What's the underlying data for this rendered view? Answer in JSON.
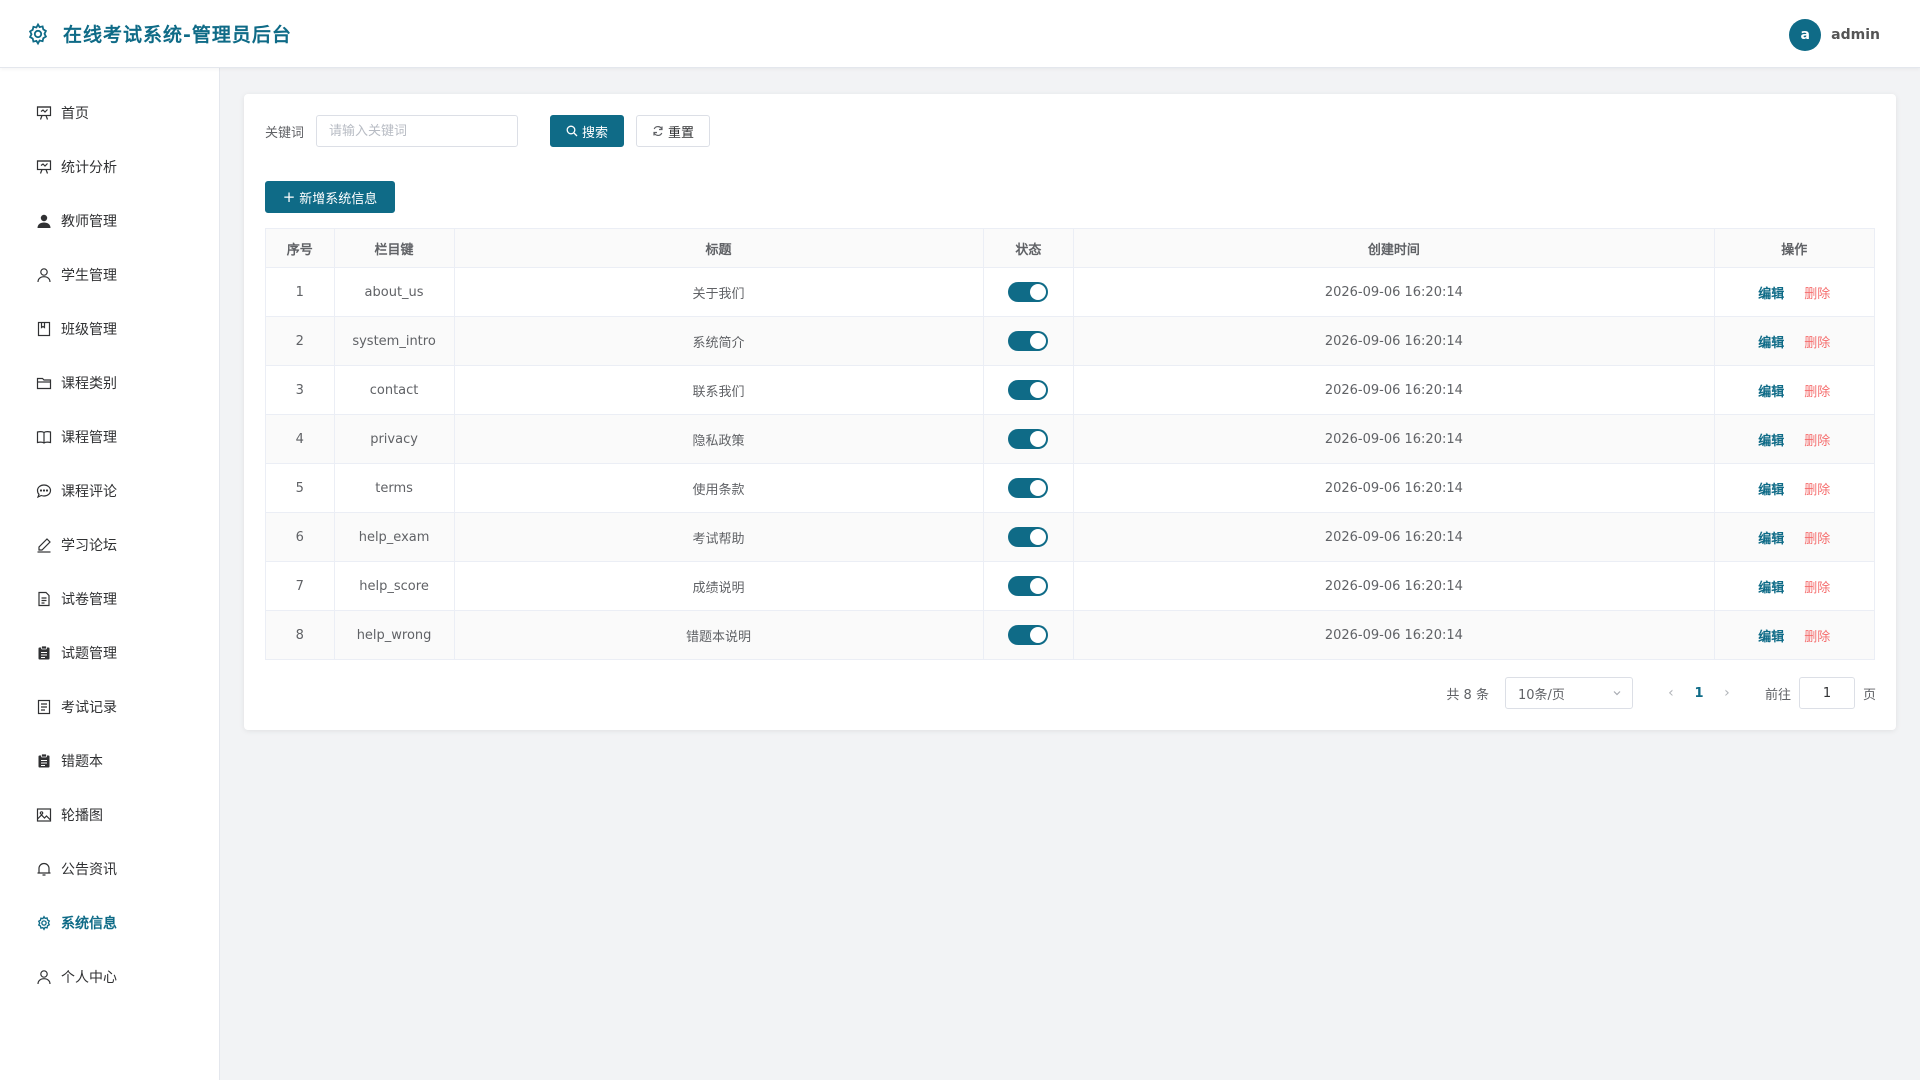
{
  "header": {
    "title": "在线考试系统-管理员后台",
    "avatar_letter": "a",
    "username": "admin"
  },
  "sidebar": {
    "items": [
      {
        "label": "首页",
        "icon": "presentation-icon"
      },
      {
        "label": "统计分析",
        "icon": "presentation-icon"
      },
      {
        "label": "教师管理",
        "icon": "user-filled-icon"
      },
      {
        "label": "学生管理",
        "icon": "user-icon"
      },
      {
        "label": "班级管理",
        "icon": "notebook-icon"
      },
      {
        "label": "课程类别",
        "icon": "folder-icon"
      },
      {
        "label": "课程管理",
        "icon": "book-icon"
      },
      {
        "label": "课程评论",
        "icon": "chat-icon"
      },
      {
        "label": "学习论坛",
        "icon": "edit-pen-icon"
      },
      {
        "label": "试卷管理",
        "icon": "document-icon"
      },
      {
        "label": "试题管理",
        "icon": "clipboard-icon"
      },
      {
        "label": "考试记录",
        "icon": "tickets-icon"
      },
      {
        "label": "错题本",
        "icon": "clipboard-icon"
      },
      {
        "label": "轮播图",
        "icon": "picture-icon"
      },
      {
        "label": "公告资讯",
        "icon": "bell-icon"
      },
      {
        "label": "系统信息",
        "icon": "gear-icon",
        "active": true
      },
      {
        "label": "个人中心",
        "icon": "user-icon"
      }
    ]
  },
  "filter": {
    "keyword_label": "关键词",
    "keyword_placeholder": "请输入关键词",
    "keyword_value": "",
    "search_label": "搜索",
    "reset_label": "重置"
  },
  "add_button_label": "新增系统信息",
  "table": {
    "columns": [
      "序号",
      "栏目键",
      "标题",
      "状态",
      "创建时间",
      "操作"
    ],
    "rows": [
      {
        "no": "1",
        "key": "about_us",
        "title": "关于我们",
        "enabled": true,
        "created": "2026-09-06 16:20:14"
      },
      {
        "no": "2",
        "key": "system_intro",
        "title": "系统简介",
        "enabled": true,
        "created": "2026-09-06 16:20:14"
      },
      {
        "no": "3",
        "key": "contact",
        "title": "联系我们",
        "enabled": true,
        "created": "2026-09-06 16:20:14"
      },
      {
        "no": "4",
        "key": "privacy",
        "title": "隐私政策",
        "enabled": true,
        "created": "2026-09-06 16:20:14"
      },
      {
        "no": "5",
        "key": "terms",
        "title": "使用条款",
        "enabled": true,
        "created": "2026-09-06 16:20:14"
      },
      {
        "no": "6",
        "key": "help_exam",
        "title": "考试帮助",
        "enabled": true,
        "created": "2026-09-06 16:20:14"
      },
      {
        "no": "7",
        "key": "help_score",
        "title": "成绩说明",
        "enabled": true,
        "created": "2026-09-06 16:20:14"
      },
      {
        "no": "8",
        "key": "help_wrong",
        "title": "错题本说明",
        "enabled": true,
        "created": "2026-09-06 16:20:14"
      }
    ],
    "edit_label": "编辑",
    "delete_label": "删除"
  },
  "pagination": {
    "total_text": "共 8 条",
    "page_size": "10条/页",
    "current_page": "1",
    "goto_label": "前往",
    "goto_value": "1",
    "page_unit": "页"
  },
  "colors": {
    "primary": "#0f6b87",
    "danger": "#f56c6c",
    "background": "#f2f3f5"
  }
}
